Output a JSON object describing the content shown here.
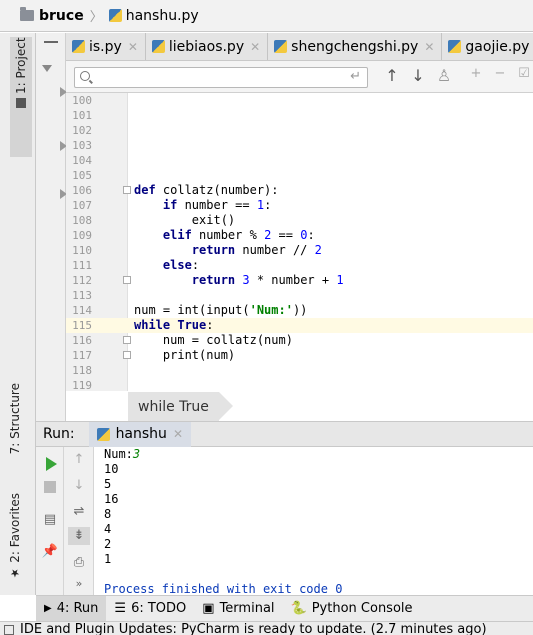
{
  "breadcrumb": {
    "project": "bruce",
    "file": "hanshu.py"
  },
  "left_strip": {
    "project_tab": "1: Project",
    "structure_tab": "7: Structure",
    "favorites_tab": "2: Favorites"
  },
  "tabs": [
    {
      "label": "is.py"
    },
    {
      "label": "liebiaos.py"
    },
    {
      "label": "shengchengshi.py"
    },
    {
      "label": "gaojie.py"
    }
  ],
  "search": {
    "value": "",
    "placeholder": ""
  },
  "editor": {
    "lines": [
      {
        "n": "100",
        "code": ""
      },
      {
        "n": "101",
        "code": ""
      },
      {
        "n": "102",
        "code": ""
      },
      {
        "n": "103",
        "code": ""
      },
      {
        "n": "104",
        "code": ""
      },
      {
        "n": "105",
        "code": ""
      },
      {
        "n": "106",
        "code": "def collatz(number):"
      },
      {
        "n": "107",
        "code": "    if number == 1:"
      },
      {
        "n": "108",
        "code": "        exit()"
      },
      {
        "n": "109",
        "code": "    elif number % 2 == 0:"
      },
      {
        "n": "110",
        "code": "        return number // 2"
      },
      {
        "n": "111",
        "code": "    else:"
      },
      {
        "n": "112",
        "code": "        return 3 * number + 1"
      },
      {
        "n": "113",
        "code": ""
      },
      {
        "n": "114",
        "code": "num = int(input('Num:'))"
      },
      {
        "n": "115",
        "code": "while True:"
      },
      {
        "n": "116",
        "code": "    num = collatz(num)"
      },
      {
        "n": "117",
        "code": "    print(num)"
      },
      {
        "n": "118",
        "code": ""
      },
      {
        "n": "119",
        "code": ""
      }
    ],
    "breadcrumb": "while True"
  },
  "run": {
    "label": "Run:",
    "config_tab": "hanshu",
    "output": {
      "prompt": "Num:",
      "input": "3",
      "values": [
        "10",
        "5",
        "16",
        "8",
        "4",
        "2",
        "1"
      ],
      "finish": "Process finished with exit code 0"
    }
  },
  "bottom_tabs": {
    "run": "4: Run",
    "todo": "6: TODO",
    "terminal": "Terminal",
    "python_console": "Python Console"
  },
  "statusbar": {
    "message": "IDE and Plugin Updates: PyCharm is ready to update. (2.7 minutes ago)"
  },
  "colors": {
    "keyword": "#000080",
    "number": "#0000ff",
    "string": "#008000",
    "console_finish": "#0a3ab8",
    "run_play": "#38a538"
  }
}
